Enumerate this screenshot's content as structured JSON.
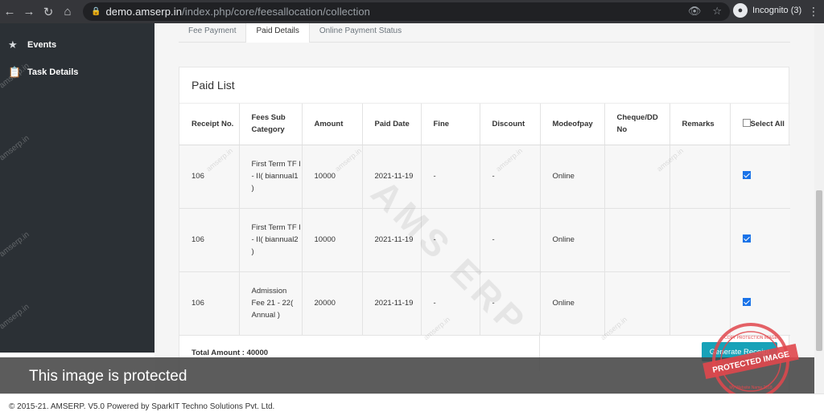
{
  "browser": {
    "url_host": "demo.amserp.in",
    "url_path": "/index.php/core/feesallocation/collection",
    "profile": "Incognito (3)"
  },
  "sidebar": {
    "items": [
      {
        "label": "Events",
        "icon": "star-icon"
      },
      {
        "label": "Task Details",
        "icon": "clipboard-icon"
      }
    ],
    "watermark": "amserp.in"
  },
  "tabs": [
    {
      "label": "Fee Payment",
      "active": false
    },
    {
      "label": "Paid Details",
      "active": true
    },
    {
      "label": "Online Payment Status",
      "active": false
    }
  ],
  "card": {
    "title": "Paid List",
    "watermark": "AMS ERP",
    "small_watermark": "amserp.in"
  },
  "table": {
    "headers": [
      "Receipt No.",
      "Fees Sub Category",
      "Amount",
      "Paid Date",
      "Fine",
      "Discount",
      "Modeofpay",
      "Cheque/DD No",
      "Remarks",
      "Select All"
    ],
    "rows": [
      {
        "receipt": "106",
        "category": "First Term TF I - II( biannual1 )",
        "amount": "10000",
        "date": "2021-11-19",
        "fine": "-",
        "discount": "-",
        "mode": "Online",
        "cheque": "",
        "remarks": "",
        "selected": true
      },
      {
        "receipt": "106",
        "category": "First Term TF I - II( biannual2 )",
        "amount": "10000",
        "date": "2021-11-19",
        "fine": "-",
        "discount": "-",
        "mode": "Online",
        "cheque": "",
        "remarks": "",
        "selected": true
      },
      {
        "receipt": "106",
        "category": "Admission Fee 21 - 22( Annual )",
        "amount": "20000",
        "date": "2021-11-19",
        "fine": "-",
        "discount": "-",
        "mode": "Online",
        "cheque": "",
        "remarks": "",
        "selected": true
      }
    ]
  },
  "total": "Total Amount : 40000",
  "generate_button": "Generate Receipt",
  "overlay": {
    "text": "This image is protected"
  },
  "stamp": {
    "top": "COPY PROTECTION IMAGE",
    "middle": "PROTECTED IMAGE",
    "bottom": "My Website Name 2018"
  },
  "footer": {
    "text": "© 2015-21. AMSERP. V5.0 Powered by SparkIT Techno Solutions Pvt. Ltd."
  },
  "colors": {
    "accent": "#17a2b8",
    "sidebar": "#2b3035",
    "stamp": "#e0474c"
  }
}
